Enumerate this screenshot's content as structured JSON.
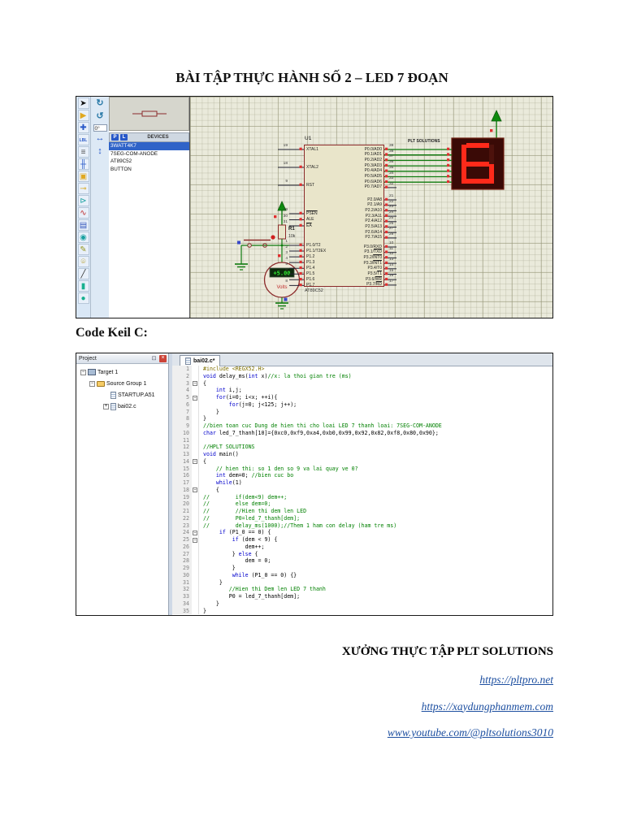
{
  "page": {
    "title": "BÀI TẬP THỰC HÀNH SỐ 2 – LED 7 ĐOẠN",
    "keil_heading": "Code Keil C:",
    "footer": {
      "org": "XƯỞNG THỰC TẬP PLT SOLUTIONS",
      "links": [
        "https://pltpro.net",
        "https://xaydungphanmem.com",
        "www.youtube.com/@pltsolutions3010"
      ]
    }
  },
  "proteus": {
    "toolbar": [
      {
        "name": "selection-cursor-icon",
        "glyph": "➤",
        "color": "#111111"
      },
      {
        "name": "component-mode-icon",
        "glyph": "▶",
        "color": "#e0a820"
      },
      {
        "name": "junction-dot-icon",
        "glyph": "✚",
        "color": "#2858c8"
      },
      {
        "name": "wire-label-icon",
        "glyph": "LBL",
        "color": "#2858c8"
      },
      {
        "name": "text-script-icon",
        "glyph": "≡",
        "color": "#555555"
      },
      {
        "name": "buses-icon",
        "glyph": "╫",
        "color": "#2858c8"
      },
      {
        "name": "subcircuit-icon",
        "glyph": "▣",
        "color": "#e0a820"
      },
      {
        "name": "terminals-icon",
        "glyph": "⊸",
        "color": "#d8a820"
      },
      {
        "name": "device-pins-icon",
        "glyph": "⊳",
        "color": "#18a0a0"
      },
      {
        "name": "graph-mode-icon",
        "glyph": "∿",
        "color": "#c03030"
      },
      {
        "name": "tape-recorder-icon",
        "glyph": "▤",
        "color": "#3355bb"
      },
      {
        "name": "generator-mode-icon",
        "glyph": "◉",
        "color": "#18a0a0"
      },
      {
        "name": "voltage-probe-icon",
        "glyph": "✎",
        "color": "#989820"
      },
      {
        "name": "current-probe-icon",
        "glyph": "⌾",
        "color": "#b8a030"
      },
      {
        "name": "2d-line-icon",
        "glyph": "╱",
        "color": "#333333"
      },
      {
        "name": "2d-box-icon",
        "glyph": "▮",
        "color": "#18b090"
      },
      {
        "name": "2d-circle-icon",
        "glyph": "●",
        "color": "#18b090"
      }
    ],
    "rotation": {
      "cw": "↻",
      "ccw": "↺",
      "angle": "0°",
      "mirror_h": "↔",
      "mirror_v": "↕"
    },
    "devices": {
      "p_label": "P",
      "l_label": "L",
      "header": "DEVICES",
      "items": [
        "3WATT4K7",
        "7SEG-COM-ANODE",
        "AT89C52",
        "BUTTON"
      ],
      "selected_index": 0
    },
    "circuit": {
      "ref": "U1",
      "part": "AT89C52",
      "brand": "PLT SOLUTIONS",
      "left_groups": [
        {
          "pins": [
            {
              "num": "19",
              "name": "XTAL1"
            },
            {
              "num": "18",
              "name": "XTAL2"
            },
            {
              "num": "9",
              "name": "RST"
            }
          ]
        },
        {
          "pins": [
            {
              "num": "29",
              "name": "PSEN",
              "bar": true
            },
            {
              "num": "30",
              "name": "ALE"
            },
            {
              "num": "31",
              "name": "EA",
              "bar": true
            }
          ]
        },
        {
          "pins": [
            {
              "num": "1",
              "name": "P1.0/T2"
            },
            {
              "num": "2",
              "name": "P1.1/T2EX"
            },
            {
              "num": "3",
              "name": "P1.2"
            },
            {
              "num": "4",
              "name": "P1.3"
            },
            {
              "num": "5",
              "name": "P1.4"
            },
            {
              "num": "6",
              "name": "P1.5"
            },
            {
              "num": "7",
              "name": "P1.6"
            },
            {
              "num": "8",
              "name": "P1.7"
            }
          ]
        }
      ],
      "right_groups": [
        {
          "pins": [
            {
              "num": "39",
              "name": "P0.0/AD0"
            },
            {
              "num": "38",
              "name": "P0.1/AD1"
            },
            {
              "num": "37",
              "name": "P0.2/AD2"
            },
            {
              "num": "36",
              "name": "P0.3/AD3"
            },
            {
              "num": "35",
              "name": "P0.4/AD4"
            },
            {
              "num": "34",
              "name": "P0.5/AD5"
            },
            {
              "num": "33",
              "name": "P0.6/AD6"
            },
            {
              "num": "32",
              "name": "P0.7/AD7"
            }
          ]
        },
        {
          "pins": [
            {
              "num": "21",
              "name": "P2.0/A8"
            },
            {
              "num": "22",
              "name": "P2.1/A9"
            },
            {
              "num": "23",
              "name": "P2.2/A10"
            },
            {
              "num": "24",
              "name": "P2.3/A11"
            },
            {
              "num": "25",
              "name": "P2.4/A12"
            },
            {
              "num": "26",
              "name": "P2.5/A13"
            },
            {
              "num": "27",
              "name": "P2.6/A14"
            },
            {
              "num": "28",
              "name": "P2.7/A15"
            }
          ]
        },
        {
          "pins": [
            {
              "num": "10",
              "name": "P3.0/RXD"
            },
            {
              "num": "11",
              "name": "P3.1/TXD",
              "barsfx": true
            },
            {
              "num": "12",
              "name": "P3.2/INT0",
              "barsfx": true
            },
            {
              "num": "13",
              "name": "P3.3/INT1",
              "barsfx": true
            },
            {
              "num": "14",
              "name": "P3.4/T0"
            },
            {
              "num": "15",
              "name": "P3.5/T1",
              "barsfx": true
            },
            {
              "num": "16",
              "name": "P3.6/WR",
              "barsfx": true
            },
            {
              "num": "17",
              "name": "P3.7/RD",
              "barsfx": true
            }
          ]
        }
      ],
      "resistor": {
        "ref": "R1",
        "value": "10k"
      },
      "voltmeter": {
        "value": "+5.00",
        "unit": "Volts"
      },
      "display": {
        "digit": "6"
      }
    }
  },
  "keil": {
    "project": {
      "title": "Project",
      "tree": [
        {
          "label": "Target 1",
          "icon": "target",
          "level": 0,
          "expander": "minus"
        },
        {
          "label": "Source Group 1",
          "icon": "folder",
          "level": 1,
          "expander": "minus"
        },
        {
          "label": "STARTUP.A51",
          "icon": "file",
          "level": 2,
          "expander": "none"
        },
        {
          "label": "bai02.c",
          "icon": "file",
          "level": 2,
          "expander": "plus"
        }
      ]
    },
    "tab": "bai02.c*",
    "code": [
      {
        "segs": [
          [
            "pp",
            "#include <REGX52.H>"
          ]
        ]
      },
      {
        "segs": [
          [
            "kw",
            "void"
          ],
          [
            "tx",
            " delay_ms("
          ],
          [
            "kw",
            "int"
          ],
          [
            "tx",
            " x)"
          ],
          [
            "cm",
            "//x: la thoi gian tre (ms)"
          ]
        ]
      },
      {
        "fold": true,
        "segs": [
          [
            "tx",
            "{"
          ]
        ]
      },
      {
        "segs": [
          [
            "tx",
            "    "
          ],
          [
            "kw",
            "int"
          ],
          [
            "tx",
            " i,j;"
          ]
        ]
      },
      {
        "fold": true,
        "segs": [
          [
            "tx",
            "    "
          ],
          [
            "kw",
            "for"
          ],
          [
            "tx",
            "(i=0; i<x; ++i){"
          ]
        ]
      },
      {
        "segs": [
          [
            "tx",
            "        "
          ],
          [
            "kw",
            "for"
          ],
          [
            "tx",
            "(j=0; j<125; j++);"
          ]
        ]
      },
      {
        "segs": [
          [
            "tx",
            "    }"
          ]
        ]
      },
      {
        "segs": [
          [
            "tx",
            "}"
          ]
        ]
      },
      {
        "segs": [
          [
            "cm",
            "//bien toan cuc Dung de hien thi cho loai LED 7 thanh loai: 7SEG-COM-ANODE"
          ]
        ]
      },
      {
        "segs": [
          [
            "kw",
            "char"
          ],
          [
            "tx",
            " led_7_thanh[10]={0xc0,0xf9,0xa4,0xb0,0x99,0x92,0x82,0xf8,0x80,0x90};"
          ]
        ]
      },
      {
        "segs": []
      },
      {
        "segs": [
          [
            "cm",
            "//HPLT SOLUTIONS"
          ]
        ]
      },
      {
        "segs": [
          [
            "kw",
            "void"
          ],
          [
            "tx",
            " main()"
          ]
        ]
      },
      {
        "fold": true,
        "segs": [
          [
            "tx",
            "{"
          ]
        ]
      },
      {
        "segs": [
          [
            "tx",
            "    "
          ],
          [
            "cm",
            "// hien thi: so 1 den so 9 va lai quay ve 0?"
          ]
        ]
      },
      {
        "segs": [
          [
            "tx",
            "    "
          ],
          [
            "kw",
            "int"
          ],
          [
            "tx",
            " dem=0; "
          ],
          [
            "cm",
            "//bien cuc bo"
          ]
        ]
      },
      {
        "segs": [
          [
            "tx",
            "    "
          ],
          [
            "kw",
            "while"
          ],
          [
            "tx",
            "(1)"
          ]
        ]
      },
      {
        "fold": true,
        "segs": [
          [
            "tx",
            "    {"
          ]
        ]
      },
      {
        "segs": [
          [
            "cm",
            "//        if(dem<9) dem++;"
          ]
        ]
      },
      {
        "segs": [
          [
            "cm",
            "//        else dem=0;"
          ]
        ]
      },
      {
        "segs": [
          [
            "cm",
            "//        //Hien thi dem len LED"
          ]
        ]
      },
      {
        "segs": [
          [
            "cm",
            "//        P0=led_7_thanh[dem];"
          ]
        ]
      },
      {
        "segs": [
          [
            "cm",
            "//        delay_ms(1000);//Them 1 ham con delay (ham tre ms)"
          ]
        ]
      },
      {
        "fold": true,
        "segs": [
          [
            "tx",
            "     "
          ],
          [
            "kw",
            "if"
          ],
          [
            "tx",
            " (P1_0 == 0) {"
          ]
        ]
      },
      {
        "fold": true,
        "segs": [
          [
            "tx",
            "         "
          ],
          [
            "kw",
            "if"
          ],
          [
            "tx",
            " (dem < 9) {"
          ]
        ]
      },
      {
        "segs": [
          [
            "tx",
            "             dem++;"
          ]
        ]
      },
      {
        "segs": [
          [
            "tx",
            "         } "
          ],
          [
            "kw",
            "else"
          ],
          [
            "tx",
            " {"
          ]
        ]
      },
      {
        "segs": [
          [
            "tx",
            "             dem = 0;"
          ]
        ]
      },
      {
        "segs": [
          [
            "tx",
            "         }"
          ]
        ]
      },
      {
        "segs": [
          [
            "tx",
            "         "
          ],
          [
            "kw",
            "while"
          ],
          [
            "tx",
            " (P1_0 == 0) {}"
          ]
        ]
      },
      {
        "segs": [
          [
            "tx",
            "     }"
          ]
        ]
      },
      {
        "segs": [
          [
            "tx",
            "        "
          ],
          [
            "cm",
            "//Hien thi Dem len LED 7 thanh"
          ]
        ]
      },
      {
        "segs": [
          [
            "tx",
            "        P0 = led_7_thanh[dem];"
          ]
        ]
      },
      {
        "segs": [
          [
            "tx",
            "    }"
          ]
        ]
      },
      {
        "segs": [
          [
            "tx",
            "}"
          ]
        ]
      }
    ]
  }
}
